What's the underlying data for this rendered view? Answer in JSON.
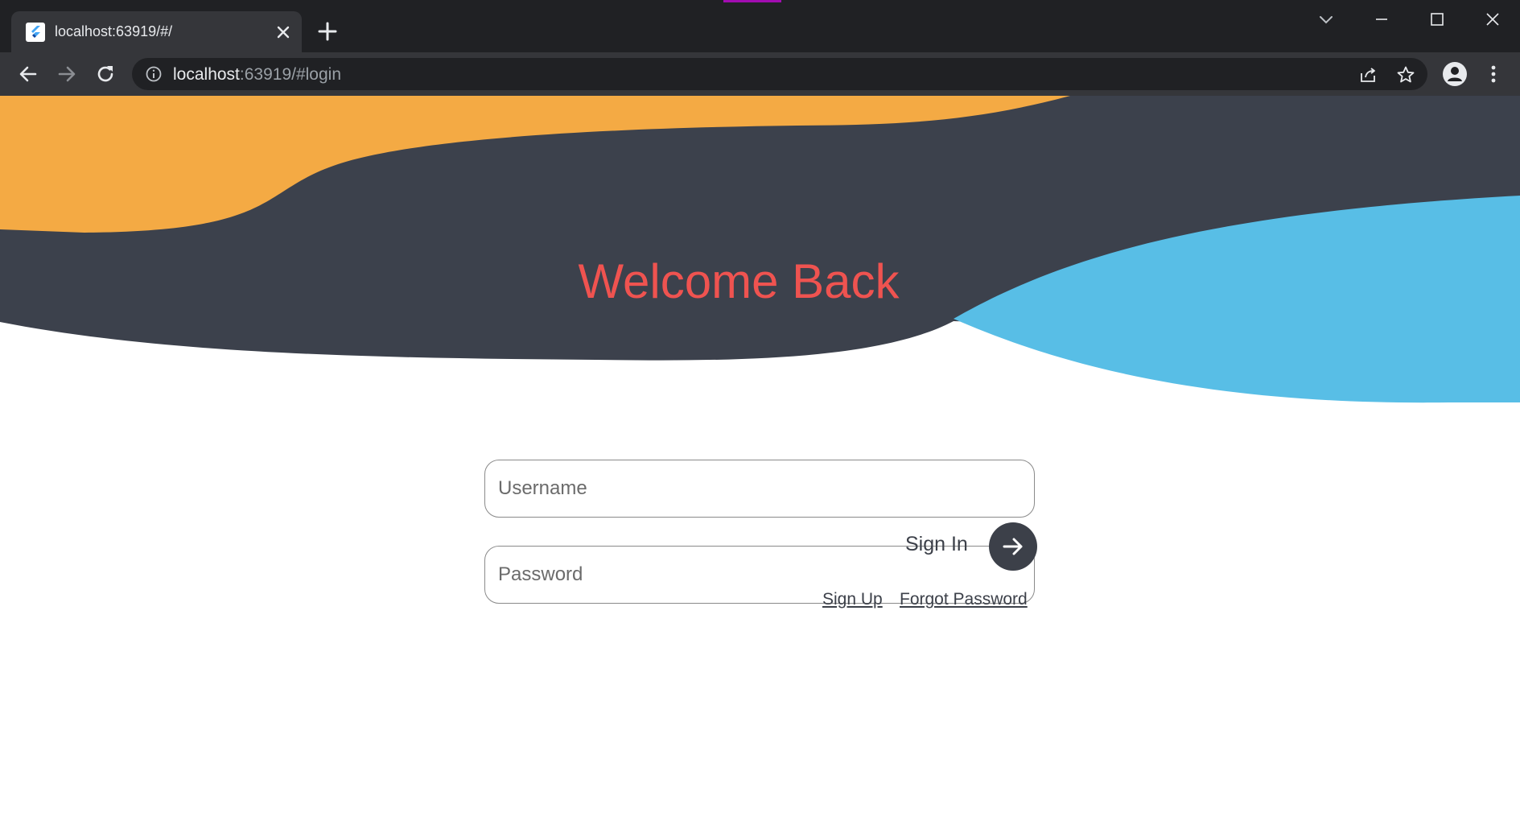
{
  "browser": {
    "tab": {
      "title": "localhost:63919/#/",
      "favicon": "flutter-icon"
    },
    "address_bar": {
      "host": "localhost",
      "rest": ":63919/#login"
    }
  },
  "page": {
    "heading": "Welcome Back",
    "username": {
      "placeholder": "Username",
      "value": ""
    },
    "password": {
      "placeholder": "Password",
      "value": ""
    },
    "sign_in_label": "Sign In",
    "sign_up_link": "Sign Up",
    "forgot_password_link": "Forgot Password"
  },
  "colors": {
    "dark_wave": "#3c414c",
    "orange_wave": "#f4aa44",
    "blue_wave": "#58bee6",
    "heading": "#ef5350",
    "button": "#3c4049"
  }
}
